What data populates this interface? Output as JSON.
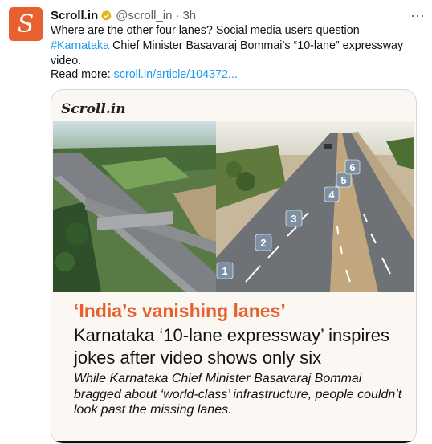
{
  "tweet": {
    "avatar_letter": "S",
    "author_name": "Scroll.in",
    "handle": "@scroll_in",
    "separator": "·",
    "time": "3h",
    "more_icon": "⋯",
    "text_part1": "Where are the other four lanes? Social media users question ",
    "hashtag": "#Karnataka",
    "text_part2": " Chief Minister Basavaraj Bommai’s “10-lane” expressway video.",
    "read_more_label": "Read more: ",
    "link": "scroll.in/article/104372..."
  },
  "card": {
    "logo": "Scroll.in",
    "kicker": "‘India’s vanishing lanes’",
    "headline": "Karnataka ‘10-lane expressway’ inspires jokes after video shows only six",
    "subhead": "While Karnataka Chief Minister Basavaraj Bommai bragged about ‘world-class’ infrastructure, people couldn’t look past the missing lanes.",
    "lane_labels": [
      "1",
      "2",
      "3",
      "4",
      "5",
      "6"
    ]
  },
  "colors": {
    "brand": "#e8602d",
    "link": "#1d9bf0",
    "muted": "#536471"
  }
}
